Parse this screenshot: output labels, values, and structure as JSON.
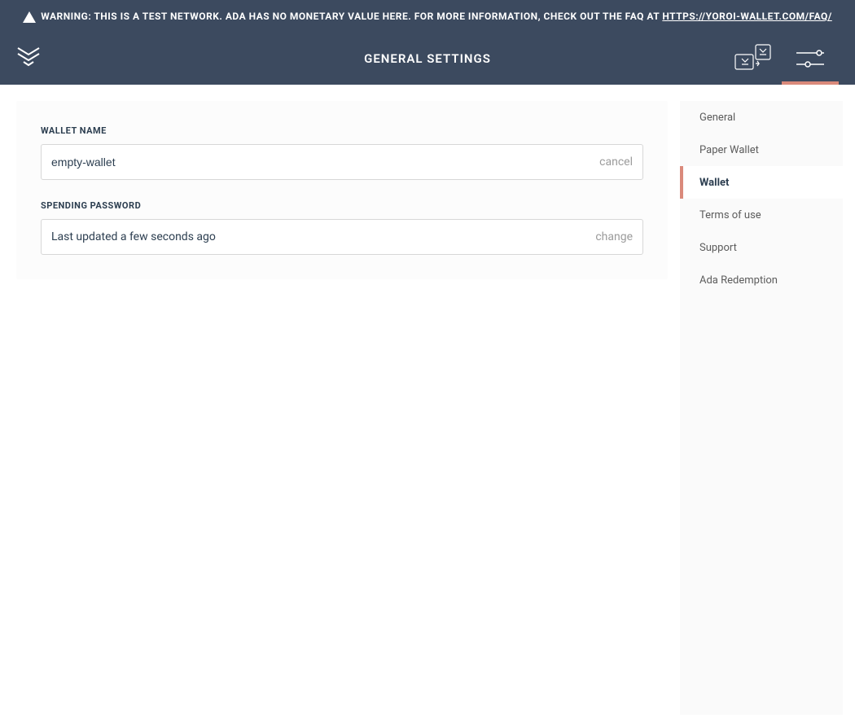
{
  "warning": {
    "text": "WARNING: THIS IS A TEST NETWORK. ADA HAS NO MONETARY VALUE HERE. FOR MORE INFORMATION, CHECK OUT THE FAQ AT ",
    "link_text": "HTTPS://YOROI-WALLET.COM/FAQ/"
  },
  "header": {
    "title": "GENERAL SETTINGS"
  },
  "main": {
    "wallet_name_label": "WALLET NAME",
    "wallet_name_value": "empty-wallet",
    "wallet_name_action": "cancel",
    "spending_password_label": "SPENDING PASSWORD",
    "spending_password_status": "Last updated a few seconds ago",
    "spending_password_action": "change"
  },
  "sidebar": {
    "items": [
      {
        "label": "General",
        "active": false
      },
      {
        "label": "Paper Wallet",
        "active": false
      },
      {
        "label": "Wallet",
        "active": true
      },
      {
        "label": "Terms of use",
        "active": false
      },
      {
        "label": "Support",
        "active": false
      },
      {
        "label": "Ada Redemption",
        "active": false
      }
    ]
  }
}
